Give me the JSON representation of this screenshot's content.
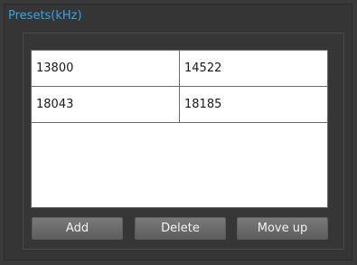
{
  "group": {
    "title": "Presets(kHz)"
  },
  "presets_table": {
    "rows": [
      [
        "13800",
        "14522"
      ],
      [
        "18043",
        "18185"
      ]
    ]
  },
  "buttons": {
    "add_label": "Add",
    "delete_label": "Delete",
    "move_up_label": "Move up"
  },
  "colors": {
    "accent": "#2fa8e6",
    "background": "#353535",
    "table_background": "#ffffff"
  }
}
